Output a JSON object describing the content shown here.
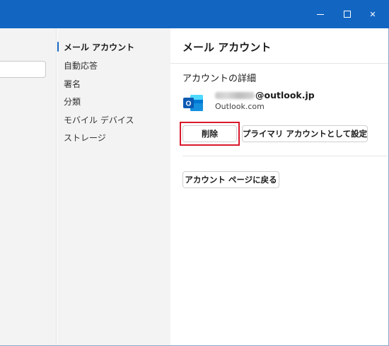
{
  "window": {
    "controls": {
      "minimize_icon": "minimize-icon",
      "maximize_icon": "maximize-icon",
      "close_icon": "close-icon",
      "close_glyph": "✕"
    },
    "titlebar_color": "#1266c2"
  },
  "nav": {
    "items": [
      {
        "label": "メール アカウント",
        "active": true
      },
      {
        "label": "自動応答",
        "active": false
      },
      {
        "label": "署名",
        "active": false
      },
      {
        "label": "分類",
        "active": false
      },
      {
        "label": "モバイル デバイス",
        "active": false
      },
      {
        "label": "ストレージ",
        "active": false
      }
    ]
  },
  "content": {
    "title": "メール アカウント",
    "details_heading": "アカウントの詳細",
    "account": {
      "email_suffix": "@outlook.jp",
      "provider": "Outlook.com",
      "logo_icon": "outlook-logo-icon",
      "logo_letter": "O"
    },
    "buttons": {
      "delete": "削除",
      "set_primary": "プライマリ アカウントとして設定",
      "back": "アカウント ページに戻る"
    }
  },
  "colors": {
    "accent": "#1266c2",
    "highlight": "#d9192b"
  }
}
